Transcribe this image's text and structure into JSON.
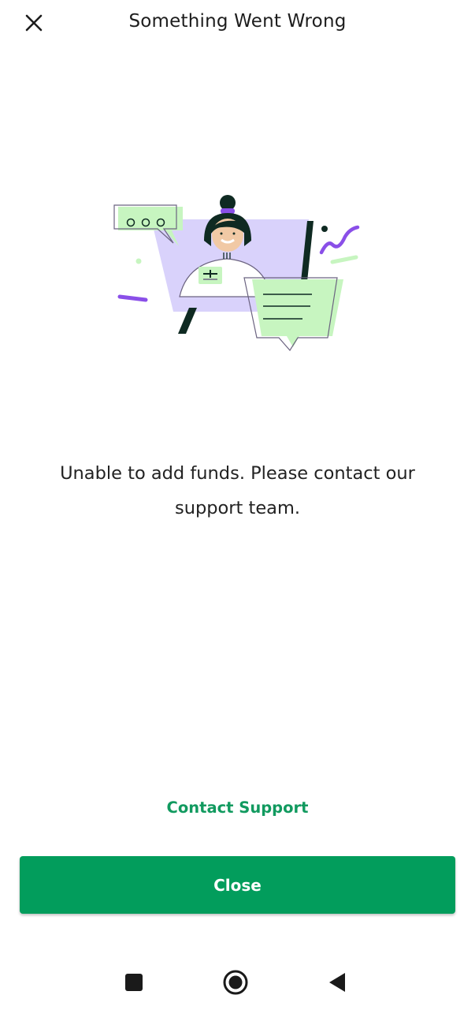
{
  "header": {
    "title": "Something Went Wrong",
    "close_icon": "close-icon"
  },
  "illustration": {
    "icon": "support-agent-illustration",
    "colors": {
      "lavender": "#d9d2fb",
      "green": "#c7f5c0",
      "purple": "#8a4fe8",
      "dark": "#0f2a22"
    }
  },
  "message": {
    "text": "Unable to add funds. Please contact our support team."
  },
  "actions": {
    "contact_support_label": "Contact Support",
    "close_label": "Close"
  },
  "nav_bar": {
    "recents_icon": "square-icon",
    "home_icon": "circle-home-icon",
    "back_icon": "triangle-back-icon"
  },
  "colors": {
    "accent": "#029d5c",
    "link": "#119a5f",
    "text": "#1d1d1d"
  }
}
